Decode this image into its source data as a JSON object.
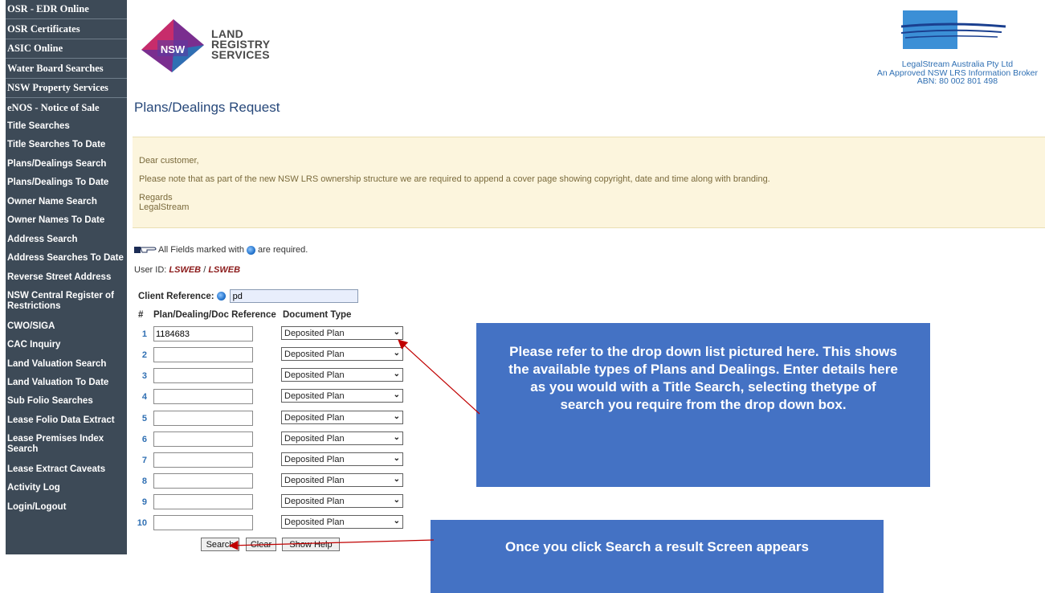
{
  "sidebar": {
    "items": [
      {
        "label": "OSR - EDR Online"
      },
      {
        "label": "OSR Certificates"
      },
      {
        "label": "ASIC Online"
      },
      {
        "label": "Water Board Searches"
      },
      {
        "label": "NSW Property Services"
      },
      {
        "label": "eNOS - Notice of Sale"
      },
      {
        "label": "Title Searches"
      },
      {
        "label": "Title Searches To Date"
      },
      {
        "label": "Plans/Dealings Search"
      },
      {
        "label": "Plans/Dealings To Date"
      },
      {
        "label": "Owner Name Search"
      },
      {
        "label": "Owner Names To Date"
      },
      {
        "label": "Address Search"
      },
      {
        "label": "Address Searches To Date"
      },
      {
        "label": "Reverse Street Address"
      },
      {
        "label": "NSW Central Register of Restrictions"
      },
      {
        "label": "CWO/SIGA"
      },
      {
        "label": "CAC Inquiry"
      },
      {
        "label": "Land Valuation Search"
      },
      {
        "label": "Land Valuation To Date"
      },
      {
        "label": "Sub Folio Searches"
      },
      {
        "label": "Lease Folio Data Extract"
      },
      {
        "label": "Lease Premises Index Search"
      },
      {
        "label": "Lease Extract Caveats"
      },
      {
        "label": "Activity Log"
      },
      {
        "label": "Login/Logout"
      }
    ]
  },
  "header": {
    "lrs_badge": "NSW",
    "lrs_line1": "LAND",
    "lrs_line2": "REGISTRY",
    "lrs_line3": "SERVICES",
    "broker_name": "LegalStream Australia Pty Ltd",
    "broker_status": "An Approved NSW LRS Information Broker",
    "broker_abn": "ABN: 80 002 801 498"
  },
  "page_title": "Plans/Dealings Request",
  "notice": {
    "greeting": "Dear customer,",
    "message": "Please note that as part of the new NSW LRS ownership structure we are required to append a cover page showing copyright, date and time along with branding.",
    "regards": "Regards",
    "signature": "LegalStream"
  },
  "required_note": {
    "prefix": "All Fields marked with",
    "suffix": "are required."
  },
  "user": {
    "label": "User ID:",
    "id1": "LSWEB",
    "sep": " / ",
    "id2": "LSWEB"
  },
  "form": {
    "client_ref_label": "Client Reference:",
    "client_ref_value": "pd",
    "col_num": "#",
    "col_ref": "Plan/Dealing/Doc Reference",
    "col_type": "Document Type",
    "rows": [
      {
        "num": "1",
        "ref": "1184683",
        "type": "Deposited Plan"
      },
      {
        "num": "2",
        "ref": "",
        "type": "Deposited Plan"
      },
      {
        "num": "3",
        "ref": "",
        "type": "Deposited Plan"
      },
      {
        "num": "4",
        "ref": "",
        "type": "Deposited Plan"
      },
      {
        "num": "5",
        "ref": "",
        "type": "Deposited Plan"
      },
      {
        "num": "6",
        "ref": "",
        "type": "Deposited Plan"
      },
      {
        "num": "7",
        "ref": "",
        "type": "Deposited Plan"
      },
      {
        "num": "8",
        "ref": "",
        "type": "Deposited Plan"
      },
      {
        "num": "9",
        "ref": "",
        "type": "Deposited Plan"
      },
      {
        "num": "10",
        "ref": "",
        "type": "Deposited Plan"
      }
    ],
    "search_label": "Search",
    "clear_label": "Clear",
    "help_label": "Show Help"
  },
  "callouts": {
    "dropdown": "Please refer to the drop down list pictured here. This shows the available types of Plans and Dealings. Enter details here as you would with a Title Search, selecting thetype of search you require from the drop down box.",
    "search": "Once you click Search a result Screen appears"
  },
  "colors": {
    "sidebar": "#3d4a57",
    "callout": "#4472c4",
    "title": "#27487a",
    "notice_bg": "#fcf5dd"
  }
}
